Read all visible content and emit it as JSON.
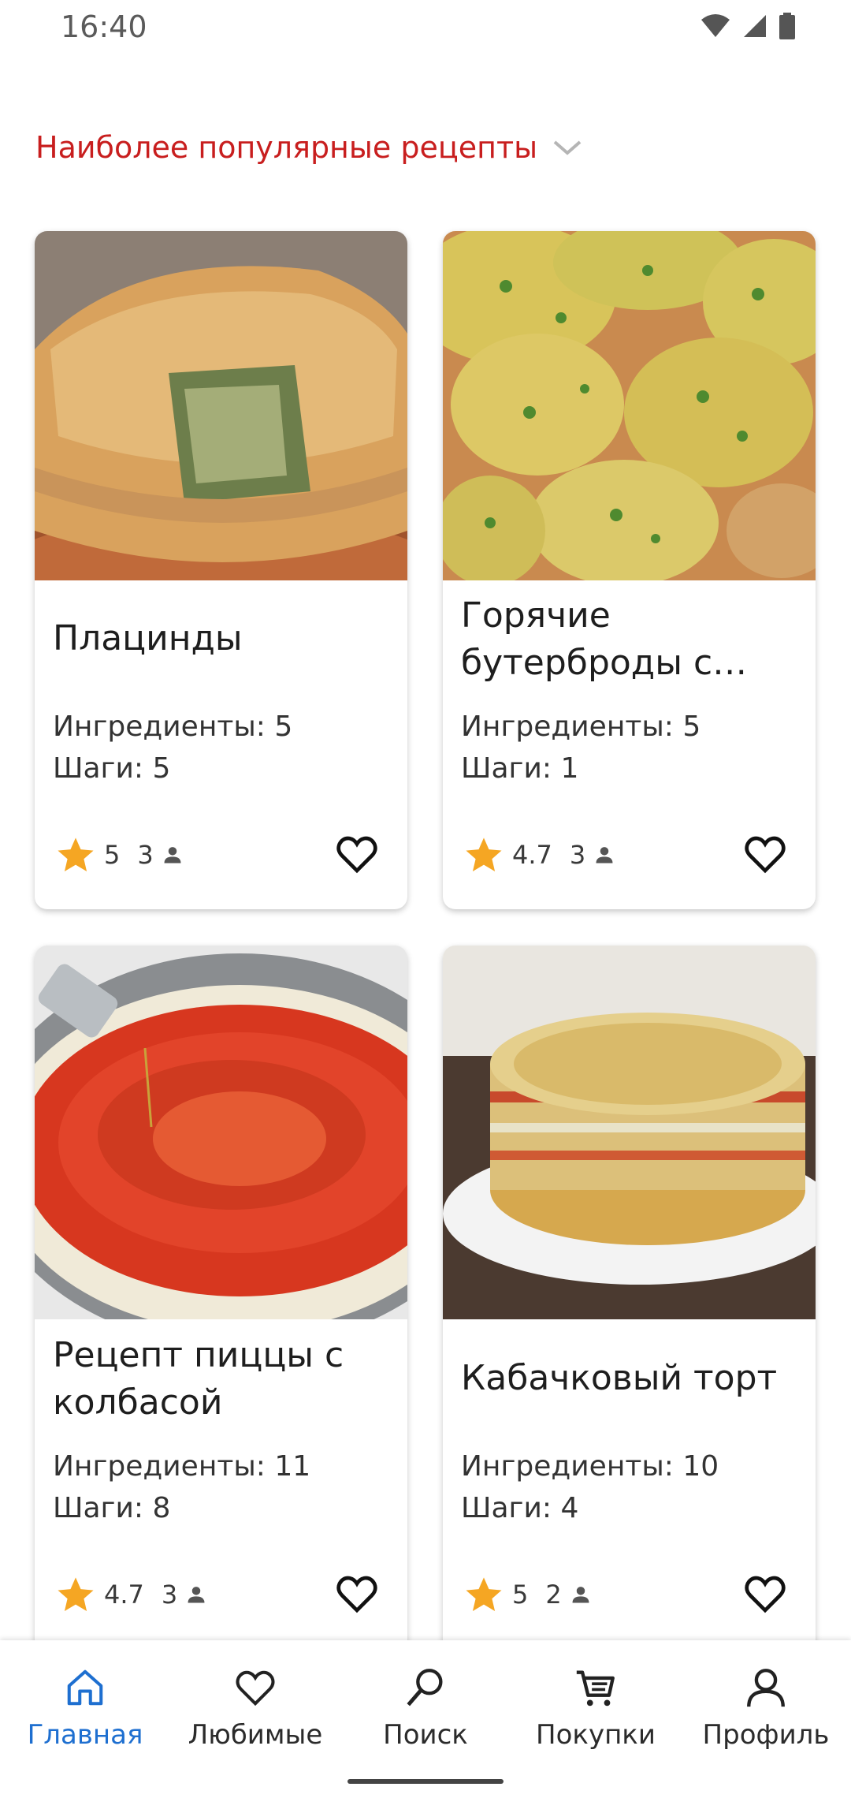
{
  "status_bar": {
    "time": "16:40"
  },
  "header": {
    "title": "Наиболее популярные рецепты",
    "dropdown_icon": "chevron-down-icon"
  },
  "labels": {
    "ingredients": "Ингредиенты: ",
    "steps": "Шаги: "
  },
  "recipes": [
    {
      "title": "Плацинды",
      "ingredients": "5",
      "steps": "5",
      "rating": "5",
      "votes": "3",
      "image": "placinda-photo"
    },
    {
      "title": "Горячие бутерброды с сыр...",
      "ingredients": "5",
      "steps": "1",
      "rating": "4.7",
      "votes": "3",
      "image": "cheese-toast-photo"
    },
    {
      "title": "Рецепт пиццы с колбасой",
      "ingredients": "11",
      "steps": "8",
      "rating": "4.7",
      "votes": "3",
      "image": "pizza-dough-photo"
    },
    {
      "title": "Кабачковый торт",
      "ingredients": "10",
      "steps": "4",
      "rating": "5",
      "votes": "2",
      "image": "zucchini-cake-photo"
    }
  ],
  "nav": {
    "items": [
      {
        "label": "Главная",
        "icon": "home-icon",
        "active": true
      },
      {
        "label": "Любимые",
        "icon": "heart-icon",
        "active": false
      },
      {
        "label": "Поиск",
        "icon": "search-icon",
        "active": false
      },
      {
        "label": "Покупки",
        "icon": "cart-icon",
        "active": false
      },
      {
        "label": "Профиль",
        "icon": "person-icon",
        "active": false
      }
    ]
  },
  "colors": {
    "accent": "#c81e1e",
    "nav_active": "#1e6fd0",
    "star": "#f5a623"
  }
}
